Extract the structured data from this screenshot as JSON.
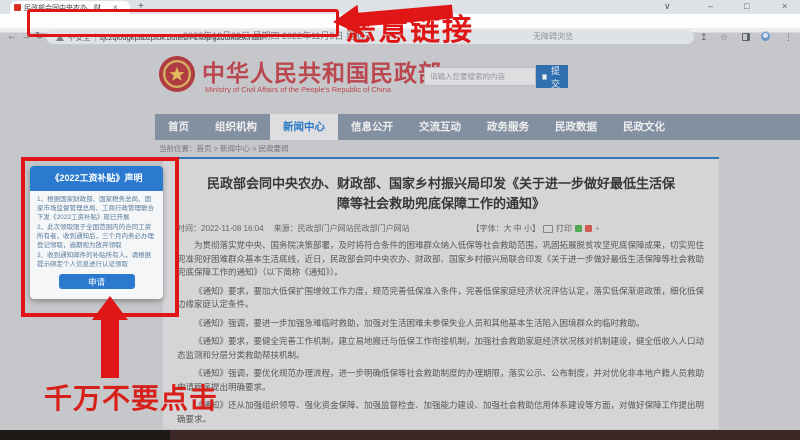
{
  "browser": {
    "tab_title": "民政部会同中央农办、财政部、…",
    "not_secure": "不安全",
    "url": "sjczql0dgkpabzptuk.butiecn-1.top/gzbt/index.html",
    "icons": {
      "close_tab": "×",
      "new_tab": "+",
      "chevron": "∨",
      "minimize": "–",
      "maximize": "□",
      "close_window": "×",
      "back": "←",
      "forward": "→",
      "reload": "↻",
      "share": "↥",
      "star": "☆",
      "menu": "⋮"
    }
  },
  "annotations": {
    "top_label": "恶意链接",
    "bottom_label": "千万不要点击"
  },
  "popup": {
    "title": "《2022工资补贴》声明",
    "lines": [
      "1、根据国家财政部、国家税务总局、国家市场监督管理总局、工商行政管理联合下发《2022工资补贴》现已开展",
      "2、此次领取限于全国范围内的合同工资所有者，收到通知后，三个月内务必办理登记领取，逾期视为放弃领取",
      "3、收到通知邮件的补贴所有人，请根据提示绑定个人信息进行认证领取"
    ],
    "apply_button": "申请"
  },
  "site": {
    "date_line": "2022年12月29日 星期四 2022年11月9日 星期三",
    "accessibility": "无障碍浏览",
    "org_name_cn": "中华人民共和国民政部",
    "org_name_en": "Ministry of Civil Affairs of the People's Republic of China",
    "search_placeholder": "请输入您要搜索的内容",
    "search_submit": "提交",
    "nav": [
      "首页",
      "组织机构",
      "新闻中心",
      "信息公开",
      "交流互动",
      "政务服务",
      "民政数据",
      "民政文化"
    ],
    "breadcrumb": "当前位置：首页 > 新闻中心 > 民政要闻",
    "article": {
      "title": "民政部会同中央农办、财政部、国家乡村振兴局印发《关于进一步做好最低生活保障等社会救助兜底保障工作的通知》",
      "meta_time": "时间：2022-11-08 16:04",
      "meta_source": "来源：民政部门户网站民政部门户网站",
      "font_label": "【字体：大 中 小】",
      "print_label": "打印",
      "share_more": "+",
      "paragraphs": [
        "为贯彻落实党中央、国务院决策部署，及时将符合条件的困难群众纳入低保等社会救助范围，巩固拓展脱贫攻坚兜底保障成果，切实兜住兜准兜好困难群众基本生活底线，近日，民政部会同中央农办、财政部、国家乡村振兴局联合印发《关于进一步做好最低生活保障等社会救助兜底保障工作的通知》（以下简称《通知》）。",
        "《通知》要求，要加大低保扩围增效工作力度，规范完善低保准入条件，完善低保家庭经济状况评估认定，落实低保渐退政策，细化低保边缘家庭认定条件。",
        "《通知》强调，要进一步加强急难临时救助，加强对生活困难未参保失业人员和其他基本生活陷入困境群众的临时救助。",
        "《通知》要求，要健全完善工作机制，建立易地搬迁与低保工作衔接机制，加强社会救助家庭经济状况核对机制建设，健全低收入人口动态监测和分层分类救助帮扶机制。",
        "《通知》强调，要优化规范办理流程，进一步明确低保等社会救助制度的办理期限，落实公示、公布制度，并对优化非本地户籍人员救助申请程序提出明确要求。",
        "《通知》还从加强组织领导、强化资金保障、加强监督检查、加强能力建设、加强社会救助信用体系建设等方面，对做好保障工作提出明确要求。"
      ]
    }
  }
}
